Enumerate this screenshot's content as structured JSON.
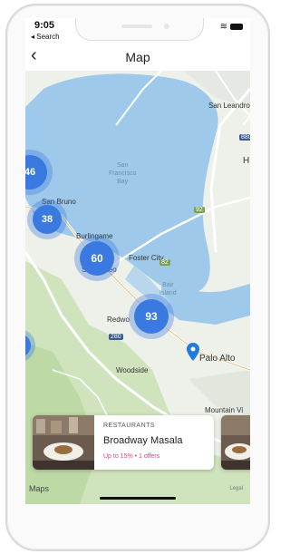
{
  "status_bar": {
    "time": "9:05",
    "back_to_app": "◂ Search"
  },
  "header": {
    "title": "Map",
    "back_icon": "chevron-left-icon"
  },
  "map": {
    "places": {
      "san_leandro": "San Leandro",
      "hayward": "H",
      "bay_label": "San\nFrancisco\nBay",
      "san_bruno": "San Bruno",
      "burlingame": "Burlingame",
      "san_mateo": "San Mateo",
      "foster_city": "Foster City",
      "bair_island": "Bair\nIsland",
      "redwood_city": "Redwo",
      "palo_alto": "Palo Alto",
      "woodside": "Woodside",
      "mountain_view": "Mountain Vi"
    },
    "road_shields": {
      "r92": "92",
      "r280": "280",
      "r82": "82",
      "i880": "880"
    },
    "clusters": [
      {
        "label": "46"
      },
      {
        "label": "38"
      },
      {
        "label": "60"
      },
      {
        "label": "93"
      }
    ],
    "pin_icon": "map-pin-icon",
    "attribution": "Maps",
    "legal": "Legal"
  },
  "card": {
    "category": "RESTAURANTS",
    "name": "Broadway Masala",
    "offer": "Up to 15% • 1 offers"
  },
  "colors": {
    "water": "#9ec9ea",
    "land": "#eef0ea",
    "park": "#c8e0b4",
    "cluster": "#3a79e0",
    "pin": "#1f7ae0",
    "offer": "#e0457b"
  }
}
